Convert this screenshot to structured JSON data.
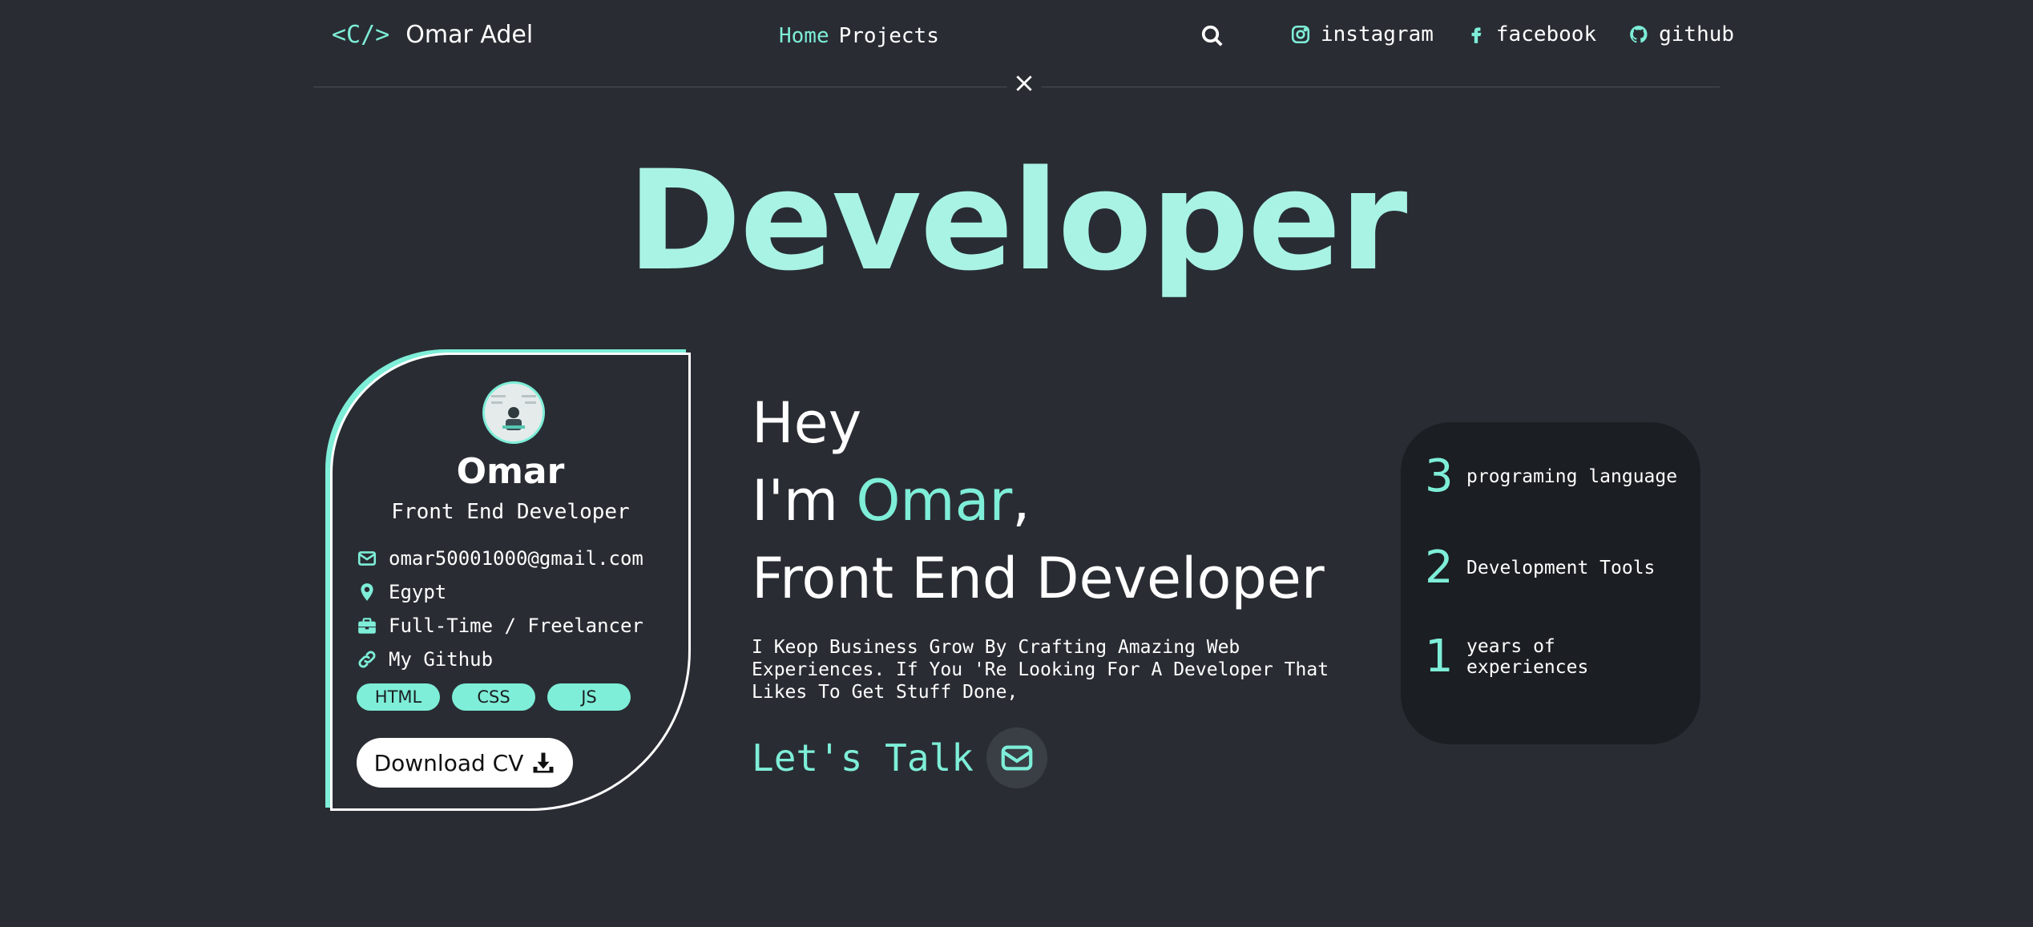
{
  "nav": {
    "logo_code": "<C/>",
    "logo_name": "Omar Adel",
    "links": [
      {
        "label": "Home",
        "active": true
      },
      {
        "label": "Projects",
        "active": false
      }
    ],
    "search_icon": "search-icon",
    "socials": [
      {
        "label": "instagram",
        "icon": "instagram-icon"
      },
      {
        "label": "facebook",
        "icon": "facebook-icon"
      },
      {
        "label": "github",
        "icon": "github-icon"
      }
    ],
    "close_icon": "close-icon"
  },
  "hero": {
    "title": "Developer"
  },
  "card": {
    "name": "Omar",
    "role": "Front End Developer",
    "email": "omar50001000@gmail.com",
    "location": "Egypt",
    "job_type": "Full-Time / Freelancer",
    "github_link": "My Github",
    "tags": [
      "HTML",
      "CSS",
      "JS"
    ],
    "download_label": "Download CV"
  },
  "intro": {
    "hey": "Hey",
    "im": "I'm ",
    "name": "Omar",
    "comma": ",",
    "role": "Front End Developer",
    "description": "I Keop Business Grow By Crafting Amazing Web Experiences. If You 'Re Looking For A Developer That Likes To Get Stuff Done,",
    "cta": "Let's Talk"
  },
  "stats": [
    {
      "number": "3",
      "label": "programing language"
    },
    {
      "number": "2",
      "label": "Development Tools"
    },
    {
      "number": "1",
      "label": "years of experiences"
    }
  ],
  "colors": {
    "background": "#292d33",
    "accent": "#7eeed8",
    "title": "#a9f3e5",
    "stats_bg": "#1b1e22"
  }
}
